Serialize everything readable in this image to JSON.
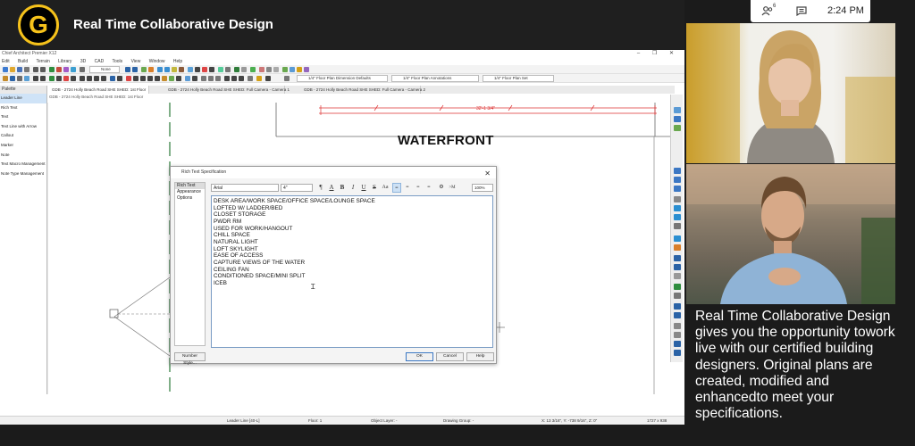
{
  "header": {
    "logo_letter": "G",
    "title": "Real Time Collaborative Design"
  },
  "cad": {
    "window_title": "Chief Architect Premier X12",
    "menu": [
      "Edit",
      "Build",
      "Terrain",
      "Library",
      "3D",
      "CAD",
      "Tools",
      "View",
      "Window",
      "Help"
    ],
    "toolbar_selects": [
      "None",
      "1/4\" Floor Plan Dimension Defaults",
      "1/4\" Floor Plan Annotations",
      "1/4\" Floor Plan Set"
    ],
    "tabs": [
      "GDB - 2724 Holly Beach Road SHE SHED: 1st Floor",
      "GDB - 2724 Holly Beach Road SHE SHED: Full Camera - Camera 1",
      "GDB - 2724 Holly Beach Road SHE SHED: Full Camera - Camera 2"
    ],
    "breadcrumb": "GDB - 2724 Holly Beach Road SHE SHED: 1st Floor",
    "palette_title": "Palette",
    "palette_items": [
      "Leader Line",
      "Rich Text",
      "Text",
      "Text Line with Arrow",
      "Callout",
      "Marker",
      "Note",
      "Text Macro Management",
      "Note Type Management"
    ],
    "dimension_label": "32'-1 3/4\"",
    "drawing_label": "WATERFRONT",
    "status": {
      "tool": "Leader Line [40-L]",
      "floor": "Floor: 1",
      "object_layer": "Object Layer: -",
      "drawing_group": "Drawing Group: -",
      "coords": "X: 13 3/16\", Y: -738 9/16\", Z: 0\"",
      "size": "1727 x 938"
    }
  },
  "dialog": {
    "title": "Rich Text Specification",
    "nav": [
      "Rich Text",
      "Appearance",
      "Options"
    ],
    "font": "Arial",
    "font_size": "4\"",
    "zoom": "100%",
    "lines": [
      "DESK AREA/WORK SPACE/OFFICE SPACE/LOUNGE SPACE",
      "LOFTED W/ LADDER/BED",
      "CLOSET STORAGE",
      "PWDR RM",
      "USED FOR WORK/HANGOUT",
      "CHILL SPACE",
      "NATURAL LIGHT",
      "LOFT SKYLIGHT",
      "EASE OF ACCESS",
      "CAPTURE VIEWS OF THE WATER",
      "CEILING FAN",
      "CONDITIONED SPACE/MINI SPLIT",
      "ICEB"
    ],
    "number_style": "Number Style...",
    "ok": "OK",
    "cancel": "Cancel",
    "help": "Help"
  },
  "call": {
    "participants": "6",
    "time": "2:24 PM",
    "caption": "Real Time Collaborative Design gives you the opportunity towork live with our certified building designers. Original plans are created, modified and enhancedto meet your specifications."
  },
  "colors": {
    "accent": "#f6c21b",
    "background": "#1b1b1b",
    "dimension": "#d33333"
  },
  "icons": [
    "people-icon",
    "chat-icon"
  ]
}
